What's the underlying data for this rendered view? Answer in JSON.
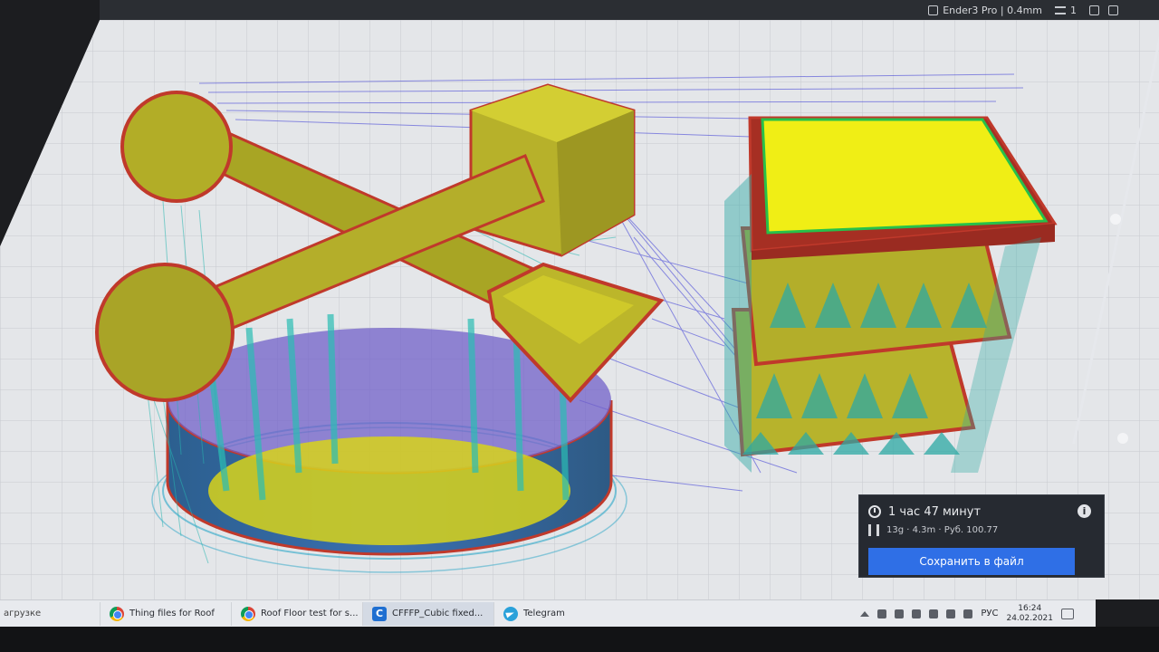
{
  "app": {
    "topbar": {
      "printer_label": "Ender3 Pro | 0.4mm",
      "material_count": "1",
      "profile_label": "",
      "infill_label": ""
    }
  },
  "print_summary": {
    "time": "1 час 47 минут",
    "material": "13g · 4.3m · Руб. 100.77",
    "save_label": "Сохранить в файл"
  },
  "taskbar": {
    "left_text": "агрузке",
    "items": [
      {
        "label": "Thing files for Roof"
      },
      {
        "label": "Roof Floor test for s..."
      },
      {
        "label": "CFFFP_Cubic fixed..."
      },
      {
        "label": "Telegram"
      }
    ],
    "lang": "РУС",
    "time": "16:24",
    "date": "24.02.2021"
  },
  "colors": {
    "accent": "#2f6fe6",
    "model_yellow": "#d8d31a",
    "support_cyan": "#27b7b0",
    "travel_blue": "#3a3ad6",
    "outline_red": "#d0302a",
    "bed": "#e4e6e9"
  }
}
